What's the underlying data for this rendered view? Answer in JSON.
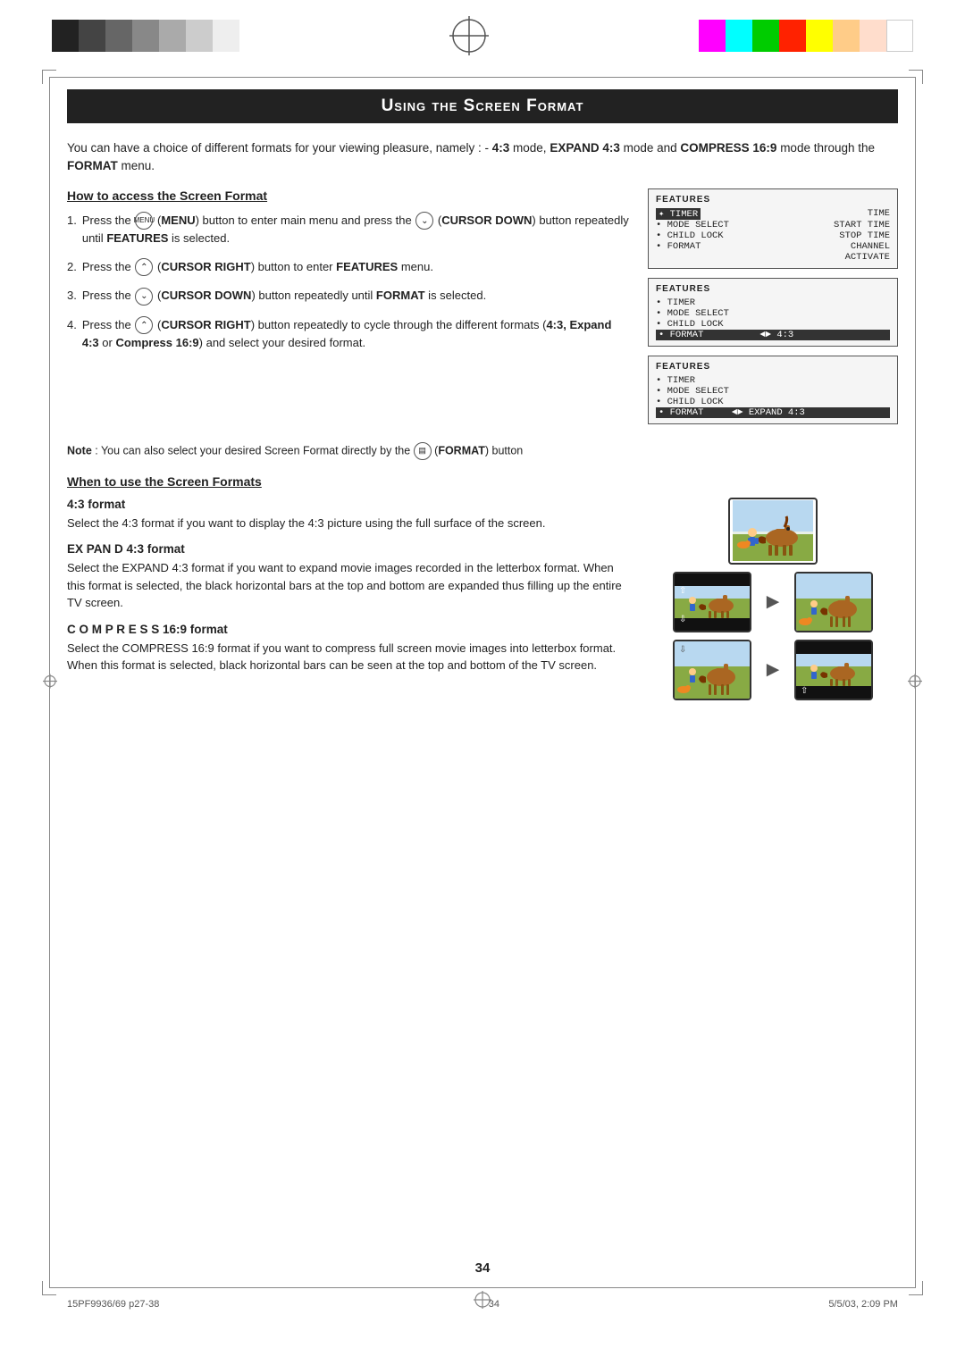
{
  "page": {
    "title": "Using the Screen Format",
    "number": "34"
  },
  "colorBarsLeft": [
    {
      "color": "#222222"
    },
    {
      "color": "#444444"
    },
    {
      "color": "#666666"
    },
    {
      "color": "#888888"
    },
    {
      "color": "#aaaaaa"
    },
    {
      "color": "#cccccc"
    },
    {
      "color": "#eeeeee"
    }
  ],
  "colorBarsRight": [
    {
      "color": "#ff00ff"
    },
    {
      "color": "#00ffff"
    },
    {
      "color": "#00ff00"
    },
    {
      "color": "#ff0000"
    },
    {
      "color": "#ffff00"
    },
    {
      "color": "#ffcc88"
    },
    {
      "color": "#ffddcc"
    },
    {
      "color": "#ffffff"
    }
  ],
  "intro": {
    "text": "You can have a choice of different formats for your viewing pleasure, namely : -",
    "bold1": "4:3",
    "text2": "mode,",
    "bold2": "EXPAND 4:3",
    "text3": "mode and",
    "bold3": "COMPRESS 16:9",
    "text4": "mode through the",
    "bold4": "FORMAT",
    "text5": "menu."
  },
  "howToAccess": {
    "heading": "How to access the Screen Format",
    "steps": [
      {
        "num": "1.",
        "parts": [
          {
            "text": "Press the ",
            "bold": false
          },
          {
            "text": "(MENU)",
            "bold": true,
            "isBtn": true
          },
          {
            "text": "button to enter main menu and press the",
            "bold": false
          },
          {
            "text": "(CURSOR DOWN)",
            "bold": true,
            "isBtn": true
          },
          {
            "text": "button repeatedly until",
            "bold": false
          },
          {
            "text": "FEATURES",
            "bold": true
          },
          {
            "text": "is selected.",
            "bold": false
          }
        ]
      },
      {
        "num": "2.",
        "parts": [
          {
            "text": "Press the ",
            "bold": false
          },
          {
            "text": "(CURSOR RIGHT)",
            "bold": true,
            "isBtn": true
          },
          {
            "text": "button to enter",
            "bold": false
          },
          {
            "text": "FEATURES",
            "bold": true
          },
          {
            "text": "menu.",
            "bold": false
          }
        ]
      },
      {
        "num": "3.",
        "parts": [
          {
            "text": "Press the ",
            "bold": false
          },
          {
            "text": "(CURSOR DOWN)",
            "bold": true,
            "isBtn": true
          },
          {
            "text": "button repeatedly until",
            "bold": false
          },
          {
            "text": "FORMAT",
            "bold": true
          },
          {
            "text": "is selected.",
            "bold": false
          }
        ]
      },
      {
        "num": "4.",
        "parts": [
          {
            "text": "Press the ",
            "bold": false
          },
          {
            "text": "(CURSOR RIGHT)",
            "bold": true,
            "isBtn": true
          },
          {
            "text": "button repeatedly to cycle through the different formats (",
            "bold": false
          },
          {
            "text": "4:3, Expand 4:3",
            "bold": true
          },
          {
            "text": "or",
            "bold": false
          },
          {
            "text": "Compress 16:9",
            "bold": true
          },
          {
            "text": ") and select your desired format.",
            "bold": false
          }
        ]
      }
    ]
  },
  "menus": [
    {
      "title": "FEATURES",
      "rows": [
        {
          "left": "✦ TIMER",
          "right": "TIME",
          "highlight": true
        },
        {
          "left": "• MODE SELECT",
          "right": "START TIME",
          "highlight": false
        },
        {
          "left": "• CHILD LOCK",
          "right": "STOP TIME",
          "highlight": false
        },
        {
          "left": "• FORMAT",
          "right": "CHANNEL",
          "highlight": false
        },
        {
          "left": "",
          "right": "ACTIVATE",
          "highlight": false
        }
      ]
    },
    {
      "title": "FEATURES",
      "rows": [
        {
          "left": "• TIMER",
          "right": "",
          "highlight": false
        },
        {
          "left": "• MODE SELECT",
          "right": "",
          "highlight": false
        },
        {
          "left": "• CHILD LOCK",
          "right": "",
          "highlight": false
        },
        {
          "left": "• FORMAT",
          "right": "◄► 4:3",
          "highlight": true
        }
      ]
    },
    {
      "title": "FEATURES",
      "rows": [
        {
          "left": "• TIMER",
          "right": "",
          "highlight": false
        },
        {
          "left": "• MODE SELECT",
          "right": "",
          "highlight": false
        },
        {
          "left": "• CHILD LOCK",
          "right": "",
          "highlight": false
        },
        {
          "left": "• FORMAT",
          "right": "◄► EXPAND 4:3",
          "highlight": true
        }
      ]
    }
  ],
  "note": {
    "label": "Note",
    "text": ": You can also select your desired Screen Format directly by the",
    "icon": "FORMAT",
    "bold": "(FORMAT)",
    "text2": "button"
  },
  "whenToUse": {
    "heading": "When to use the Screen Formats",
    "formats": [
      {
        "heading": "4:3 format",
        "headingStyle": "normal",
        "text": "Select the 4:3 format if you want to display the 4:3 picture using the full surface of the screen."
      },
      {
        "heading": "EXPAND 4:3 format",
        "headingStyle": "bold",
        "text": "Select the EXPAND 4:3 format if you want to expand movie images recorded in the letterbox format. When this format is selected, the black horizontal bars at the top and bottom are expanded thus filling up the entire TV screen."
      },
      {
        "heading": "COMPRESS 16:9 format",
        "headingStyle": "bold",
        "text": "Select the COMPRESS 16:9 format if you want to compress full screen movie images into letterbox format. When this format is selected, black horizontal bars can be seen at the top and bottom of the TV screen."
      }
    ]
  },
  "footer": {
    "left": "15PF9936/69 p27-38",
    "center": "34",
    "right": "5/5/03, 2:09 PM"
  }
}
